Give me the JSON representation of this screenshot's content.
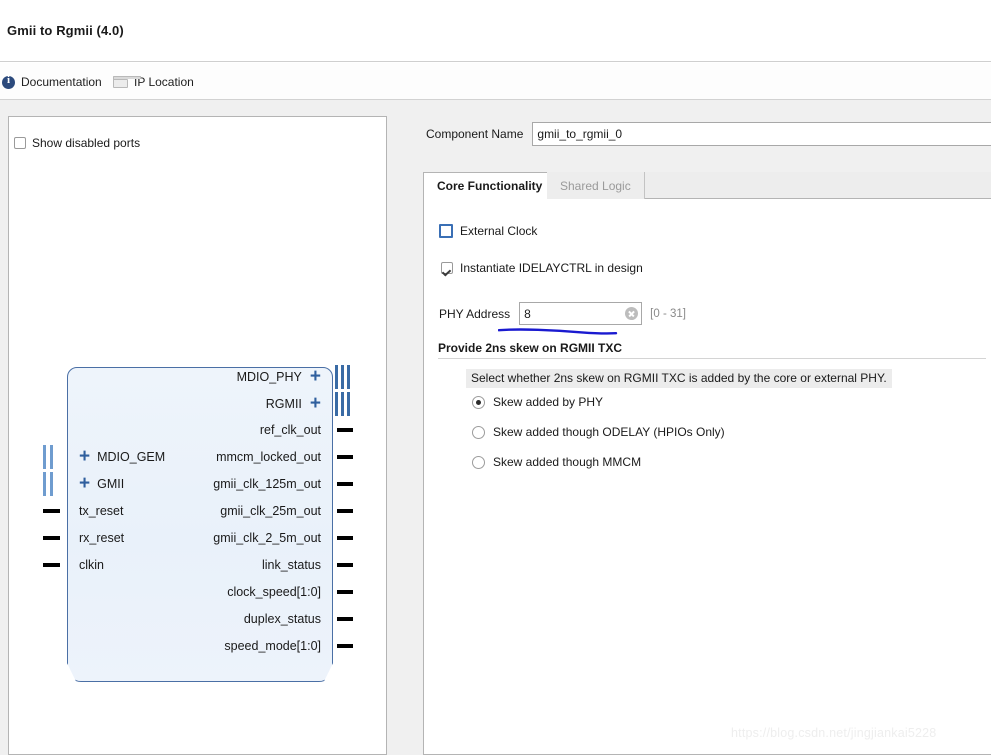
{
  "window": {
    "title": "Gmii to Rgmii (4.0)"
  },
  "toolbar": {
    "documentation_label": "Documentation",
    "documentation_icon": "info-circle-icon",
    "ip_location_label": "IP Location",
    "ip_location_icon": "folder-icon"
  },
  "diagram_panel": {
    "show_disabled_ports_label": "Show disabled ports",
    "show_disabled_ports_checked": false,
    "symbol": {
      "input_ports": [
        {
          "name": "MDIO_GEM",
          "kind": "bus",
          "expandable": true
        },
        {
          "name": "GMII",
          "kind": "bus",
          "expandable": true
        },
        {
          "name": "tx_reset",
          "kind": "single",
          "expandable": false
        },
        {
          "name": "rx_reset",
          "kind": "single",
          "expandable": false
        },
        {
          "name": "clkin",
          "kind": "single",
          "expandable": false
        }
      ],
      "output_ports": [
        {
          "name": "MDIO_PHY",
          "kind": "bus",
          "expandable": true
        },
        {
          "name": "RGMII",
          "kind": "bus",
          "expandable": true
        },
        {
          "name": "ref_clk_out",
          "kind": "single",
          "expandable": false
        },
        {
          "name": "mmcm_locked_out",
          "kind": "single",
          "expandable": false
        },
        {
          "name": "gmii_clk_125m_out",
          "kind": "single",
          "expandable": false
        },
        {
          "name": "gmii_clk_25m_out",
          "kind": "single",
          "expandable": false
        },
        {
          "name": "gmii_clk_2_5m_out",
          "kind": "single",
          "expandable": false
        },
        {
          "name": "link_status",
          "kind": "single",
          "expandable": false
        },
        {
          "name": "clock_speed[1:0]",
          "kind": "single",
          "expandable": false
        },
        {
          "name": "duplex_status",
          "kind": "single",
          "expandable": false
        },
        {
          "name": "speed_mode[1:0]",
          "kind": "single",
          "expandable": false
        }
      ]
    }
  },
  "config": {
    "component_name_label": "Component Name",
    "component_name_value": "gmii_to_rgmii_0",
    "tabs": [
      {
        "label": "Core Functionality",
        "active": true
      },
      {
        "label": "Shared Logic",
        "active": false
      }
    ],
    "external_clock_label": "External Clock",
    "external_clock_checked": false,
    "instantiate_idelayctrl_label": "Instantiate IDELAYCTRL in design",
    "instantiate_idelayctrl_checked": true,
    "phy_address_label": "PHY Address",
    "phy_address_value": "8",
    "phy_address_range": "[0 - 31]",
    "clear_icon": "clear-circle-icon",
    "skew_section_title": "Provide 2ns skew on RGMII TXC",
    "skew_hint": "Select whether 2ns skew on RGMII TXC is added by the core or external PHY.",
    "skew_options": [
      {
        "label": "Skew added by PHY",
        "selected": true
      },
      {
        "label": "Skew added though ODELAY (HPIOs Only)",
        "selected": false
      },
      {
        "label": "Skew added though MMCM",
        "selected": false
      }
    ]
  },
  "annotation": {
    "underline_color": "#1a1ad0"
  },
  "watermark": {
    "text": "https://blog.csdn.net/jingjiankai5228"
  }
}
